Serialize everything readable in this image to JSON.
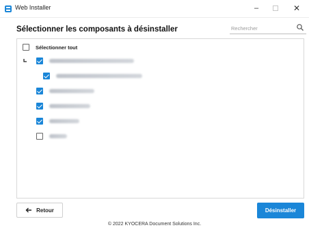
{
  "window": {
    "title": "Web Installer",
    "minimize_glyph": "–",
    "close_glyph": "✕"
  },
  "page": {
    "heading": "Sélectionner les composants à désinstaller"
  },
  "search": {
    "placeholder": "Rechercher",
    "value": ""
  },
  "list": {
    "select_all": {
      "label": "Sélectionner tout",
      "checked": false
    },
    "items": [
      {
        "checked": true,
        "level": 0,
        "expandable": true
      },
      {
        "checked": true,
        "level": 1,
        "expandable": false
      },
      {
        "checked": true,
        "level": 0,
        "expandable": false
      },
      {
        "checked": true,
        "level": 0,
        "expandable": false
      },
      {
        "checked": true,
        "level": 0,
        "expandable": false
      },
      {
        "checked": false,
        "level": 0,
        "expandable": false
      }
    ]
  },
  "buttons": {
    "back_label": "Retour",
    "uninstall_label": "Désinstaller"
  },
  "footer": {
    "copyright": "© 2022 KYOCERA Document Solutions Inc."
  },
  "colors": {
    "accent": "#1a86d8"
  },
  "icons": {
    "app": "app-icon",
    "search": "search-icon",
    "back": "arrow-left-icon",
    "expander": "tree-expander-icon"
  }
}
